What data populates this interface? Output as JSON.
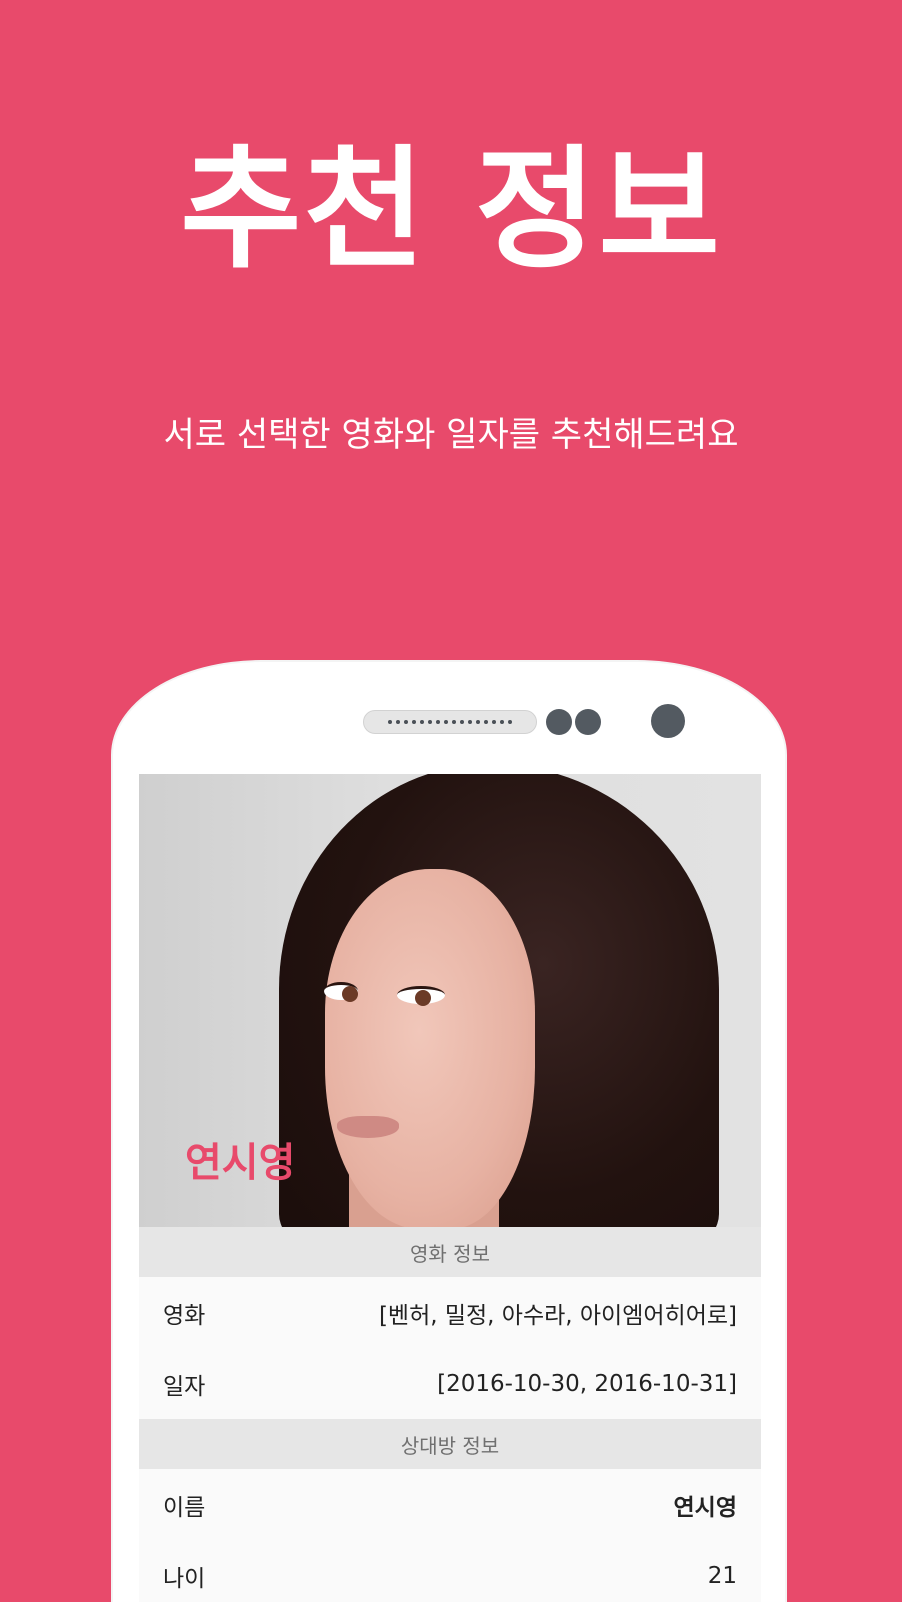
{
  "headline": "추천 정보",
  "subline": "서로 선택한 영화와 일자를 추천해드려요",
  "profile": {
    "name": "연시영"
  },
  "sections": {
    "movie_info": {
      "title": "영화 정보",
      "rows": [
        {
          "label": "영화",
          "value": "[벤허, 밀정, 아수라, 아이엠어히어로]"
        },
        {
          "label": "일자",
          "value": "[2016-10-30, 2016-10-31]"
        }
      ]
    },
    "partner_info": {
      "title": "상대방 정보",
      "rows": [
        {
          "label": "이름",
          "value": "연시영"
        },
        {
          "label": "나이",
          "value": "21"
        }
      ]
    }
  },
  "colors": {
    "brand": "#e84a6b",
    "section_header_bg": "#e6e6e6",
    "list_bg": "#fafafa"
  }
}
